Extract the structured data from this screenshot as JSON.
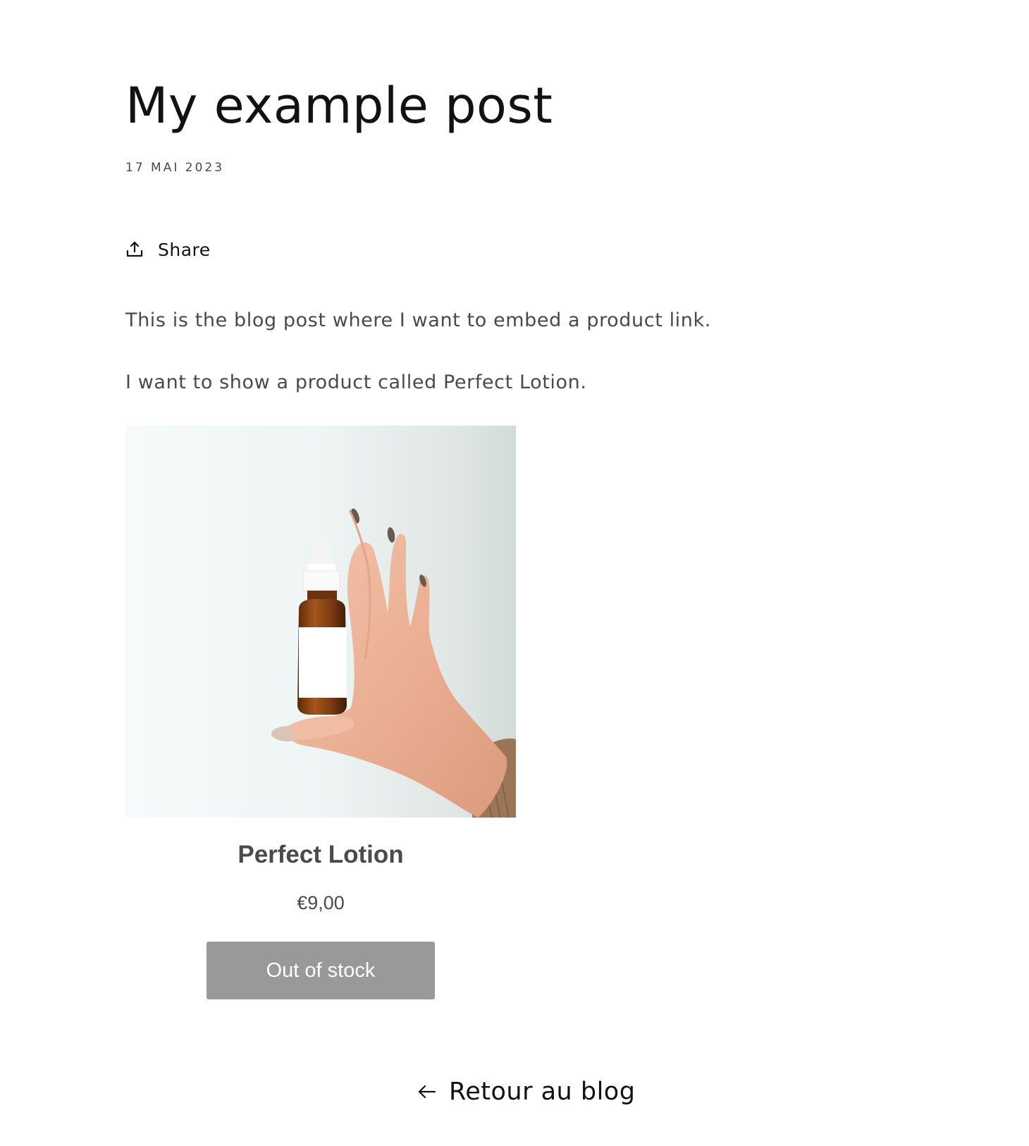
{
  "article": {
    "title": "My example post",
    "date": "17 MAI 2023",
    "share_label": "Share",
    "paragraphs": [
      "This is the blog post where I want to embed a product link.",
      "I want to show a product called Perfect Lotion."
    ]
  },
  "product": {
    "image_icon": "product-photo-hand-holding-dropper-bottle",
    "title": "Perfect Lotion",
    "price": "€9,00",
    "button_label": "Out of stock",
    "button_color": "#999999"
  },
  "navigation": {
    "back_label": "Retour au blog",
    "back_icon": "arrow-left-icon"
  },
  "colors": {
    "heading": "#121212",
    "body_text": "#4a4a4a",
    "background": "#ffffff"
  }
}
